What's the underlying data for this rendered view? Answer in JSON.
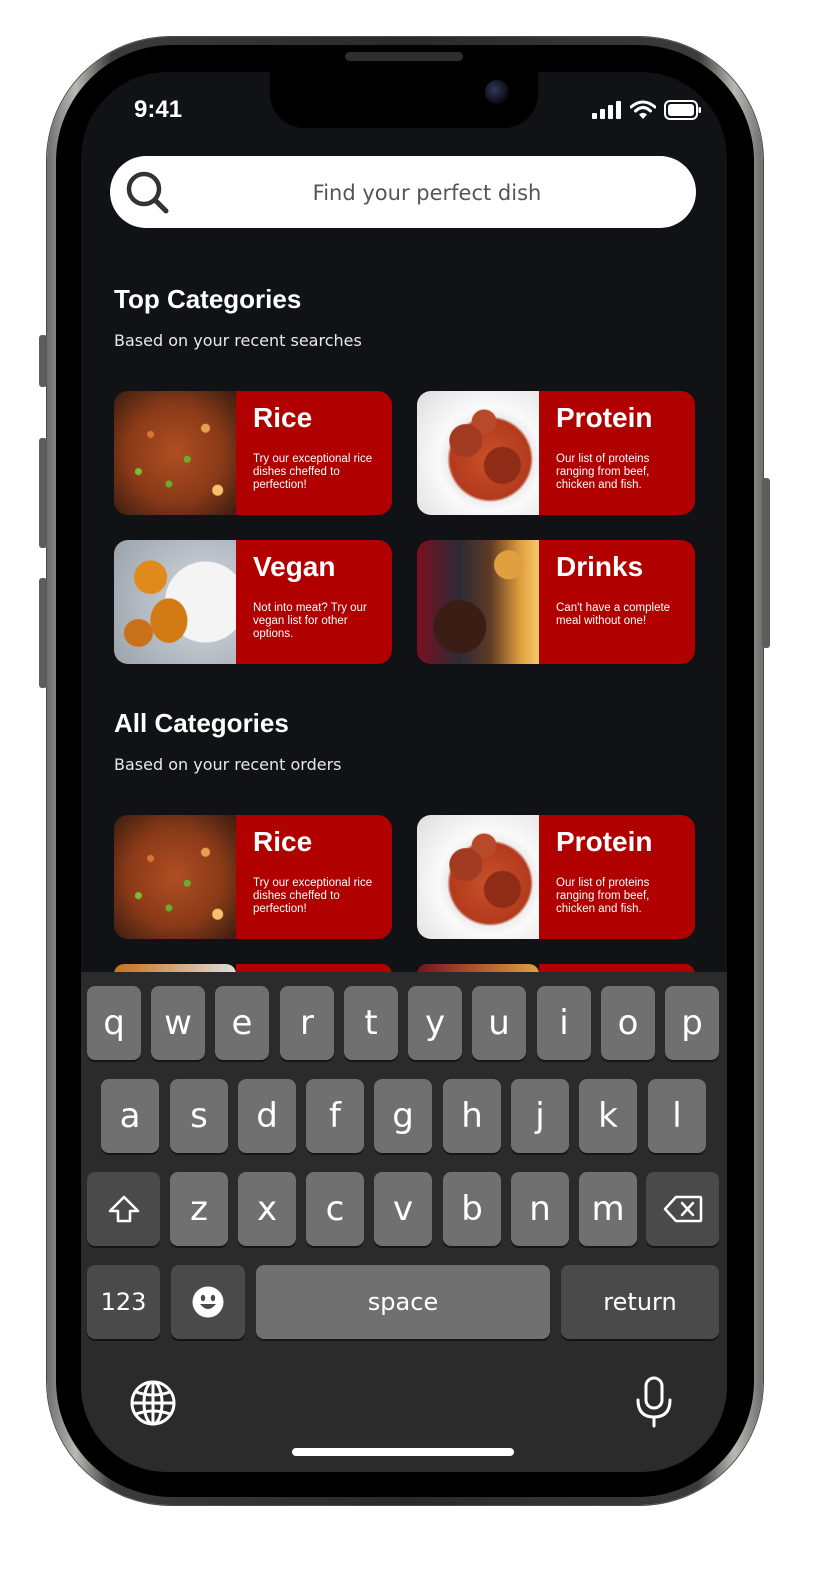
{
  "status_bar": {
    "time": "9:41"
  },
  "search": {
    "placeholder": "Find your perfect dish"
  },
  "top_categories": {
    "title": "Top Categories",
    "subtitle": "Based on your recent searches",
    "cards": [
      {
        "name": "Rice",
        "description": "Try our exceptional rice dishes cheffed to perfection!",
        "image": "jollof-rice-photo"
      },
      {
        "name": "Protein",
        "description": "Our list of proteins ranging from beef, chicken and fish.",
        "image": "beef-stew-photo"
      },
      {
        "name": "Vegan",
        "description": "Not into meat? Try our vegan list for other options.",
        "image": "fried-plantain-photo"
      },
      {
        "name": "Drinks",
        "description": "Can't have a complete meal without one!",
        "image": "drinks-photo"
      }
    ]
  },
  "all_categories": {
    "title": "All Categories",
    "subtitle": "Based on your recent orders",
    "cards": [
      {
        "name": "Rice",
        "description": "Try our exceptional rice dishes cheffed to perfection!",
        "image": "jollof-rice-photo"
      },
      {
        "name": "Protein",
        "description": "Our list of proteins ranging from beef, chicken and fish.",
        "image": "beef-stew-photo"
      }
    ]
  },
  "keyboard": {
    "row1": [
      "q",
      "w",
      "e",
      "r",
      "t",
      "y",
      "u",
      "i",
      "o",
      "p"
    ],
    "row2": [
      "a",
      "s",
      "d",
      "f",
      "g",
      "h",
      "j",
      "k",
      "l"
    ],
    "row3": [
      "z",
      "x",
      "c",
      "v",
      "b",
      "n",
      "m"
    ],
    "numbers_label": "123",
    "space_label": "space",
    "return_label": "return",
    "shift_icon": "shift-icon",
    "backspace_icon": "backspace-icon",
    "emoji_icon": "emoji-icon",
    "globe_icon": "globe-icon",
    "mic_icon": "microphone-icon"
  },
  "colors": {
    "card_red": "#b00000",
    "screen_bg": "#111215",
    "keyboard_bg": "#2b2b2c",
    "key_bg": "#707070",
    "key_dark_bg": "#4a4a4a"
  }
}
